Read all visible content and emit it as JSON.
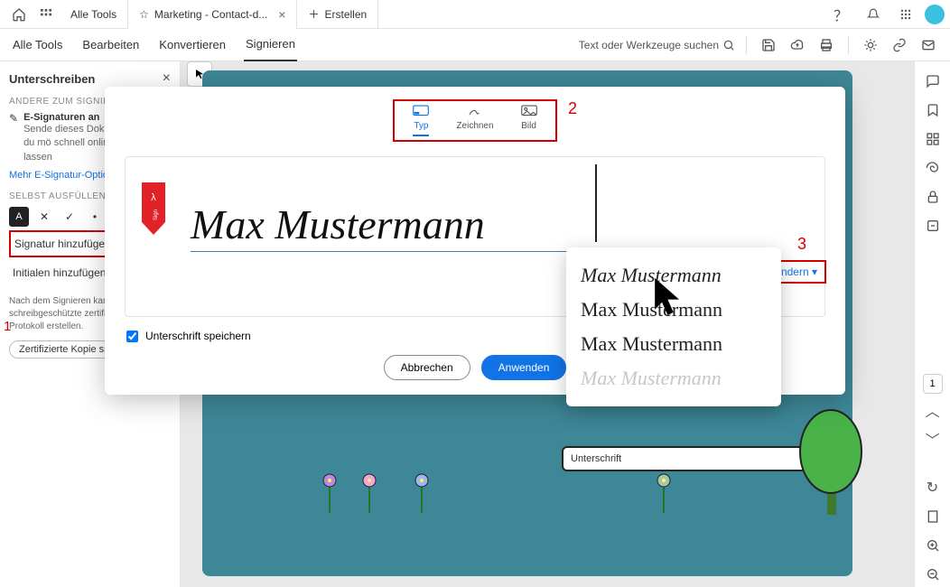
{
  "topbar": {
    "all_tools": "Alle Tools",
    "active_tab": "Marketing - Contact-d...",
    "create": "Erstellen"
  },
  "subbar": {
    "all_tools": "Alle Tools",
    "edit": "Bearbeiten",
    "convert": "Konvertieren",
    "sign": "Signieren",
    "search_placeholder": "Text oder Werkzeuge suchen"
  },
  "leftpanel": {
    "title": "Unterschreiben",
    "section_others": "ANDERE ZUM SIGNIEREN A",
    "esig_title": "E-Signaturen an",
    "esig_desc": "Sende dieses Doku auch immer du mö schnell online elek zu lassen",
    "more_options": "Mehr E-Signatur-Option",
    "section_self": "SELBST AUSFÜLLEN UND S",
    "add_signature": "Signatur hinzufügen",
    "add_initials": "Initialen hinzufügen",
    "note": "Nach dem Signieren kannst schreibgeschützte zertifizie Audit-Protokoll erstellen.",
    "cert_copy": "Zertifizierte Kopie speichern"
  },
  "modal": {
    "tab_type": "Typ",
    "tab_draw": "Zeichnen",
    "tab_image": "Bild",
    "signature_name": "Max Mustermann",
    "change_style": "Stil ändern ",
    "save_sig": "Unterschrift speichern",
    "cancel": "Abbrechen",
    "apply": "Anwenden",
    "style_options": [
      "Max Mustermann",
      "Max Mustermann",
      "Max Mustermann",
      "Max Mustermann"
    ]
  },
  "annotations": {
    "one": "1",
    "two": "2",
    "three": "3"
  },
  "canvas": {
    "signature_field": "Unterschrift"
  },
  "rightrail": {
    "page": "1"
  }
}
